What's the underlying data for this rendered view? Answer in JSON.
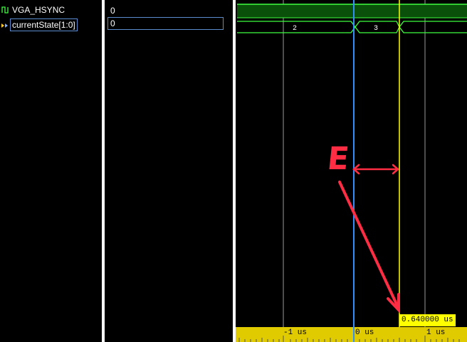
{
  "signals": [
    {
      "name": "VGA_HSYNC",
      "icon": "wire-signal-icon",
      "value": "0"
    },
    {
      "name": "currentState[1:0]",
      "icon": "bus-signal-icon",
      "value": "0"
    }
  ],
  "wave": {
    "bus_segments": [
      "2",
      "3"
    ]
  },
  "timeline": {
    "labels": [
      "-1 us",
      "0 us",
      "1 us"
    ]
  },
  "cursor": {
    "readout": "0.640000 us"
  },
  "annotation": {
    "letter": "E"
  },
  "colors": {
    "cursor_blue": "#2f8fff",
    "cursor_yellow": "#ffff00",
    "wave_green": "#3fff3f",
    "hsync_fill": "#0a4f0a",
    "annotation_red": "#ff2d44",
    "timeline_bg": "#e0cb00"
  }
}
